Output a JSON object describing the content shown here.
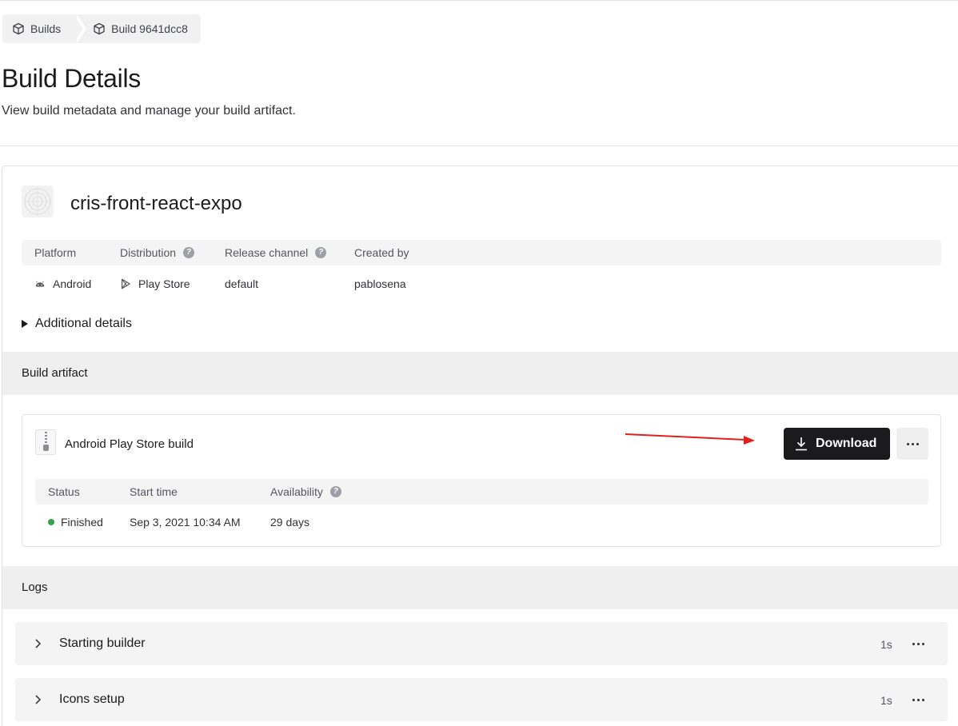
{
  "breadcrumb": {
    "items": [
      {
        "label": "Builds",
        "icon": "cube-icon"
      },
      {
        "label": "Build 9641dcc8",
        "icon": "cube-icon"
      }
    ]
  },
  "header": {
    "title": "Build Details",
    "subtitle": "View build metadata and manage your build artifact."
  },
  "app": {
    "name": "cris-front-react-expo"
  },
  "metadata": {
    "headers": {
      "platform": "Platform",
      "distribution": "Distribution",
      "release_channel": "Release channel",
      "created_by": "Created by"
    },
    "values": {
      "platform": "Android",
      "distribution": "Play Store",
      "release_channel": "default",
      "created_by": "pablosena"
    }
  },
  "additional_details": "Additional details",
  "artifact_section": {
    "title": "Build artifact",
    "artifact_name": "Android Play Store build",
    "download_label": "Download",
    "headers": {
      "status": "Status",
      "start_time": "Start time",
      "availability": "Availability"
    },
    "values": {
      "status": "Finished",
      "start_time": "Sep 3, 2021 10:34 AM",
      "availability": "29 days"
    }
  },
  "logs_section": {
    "title": "Logs",
    "items": [
      {
        "label": "Starting builder",
        "duration": "1s"
      },
      {
        "label": "Icons setup",
        "duration": "1s"
      }
    ]
  },
  "colors": {
    "primary_button": "#1b1b1d",
    "status_finished": "#2fa44f",
    "annotation_arrow": "#e0201c"
  }
}
